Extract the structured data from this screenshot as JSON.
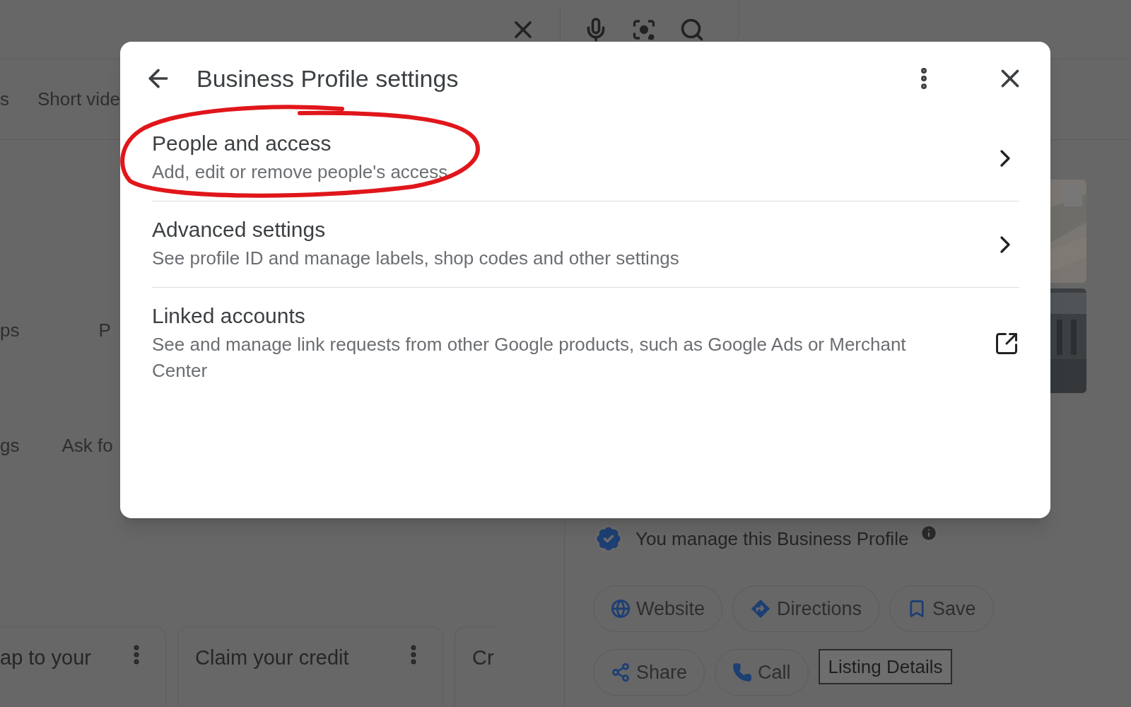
{
  "tabs": [
    {
      "label": "s",
      "selected": false
    },
    {
      "label": "Short vide",
      "selected": false
    }
  ],
  "shortcuts": [
    [
      "ps",
      "P"
    ],
    [
      "gs",
      "Ask fo"
    ]
  ],
  "cards": [
    {
      "title": "ap to your"
    },
    {
      "title": "Claim your credit"
    },
    {
      "title": "Cr"
    }
  ],
  "profile": {
    "managed_text": "You manage this Business Profile",
    "actions": [
      {
        "label": "Website",
        "kind": "pill"
      },
      {
        "label": "Directions",
        "kind": "pill"
      },
      {
        "label": "Save",
        "kind": "pill"
      },
      {
        "label": "Share",
        "kind": "pill"
      },
      {
        "label": "Call",
        "kind": "pill"
      },
      {
        "label": "Listing Details",
        "kind": "outlined"
      }
    ]
  },
  "dialog": {
    "title": "Business Profile settings",
    "items": [
      {
        "title": "People and access",
        "description": "Add, edit or remove people's access",
        "kind": "chevron",
        "circled": true
      },
      {
        "title": "Advanced settings",
        "description": "See profile ID and manage labels, shop codes and other settings",
        "kind": "chevron",
        "circled": false
      },
      {
        "title": "Linked accounts",
        "description": "See and manage link requests from other Google products, such as Google Ads or Merchant Center",
        "kind": "external",
        "circled": false
      }
    ]
  }
}
